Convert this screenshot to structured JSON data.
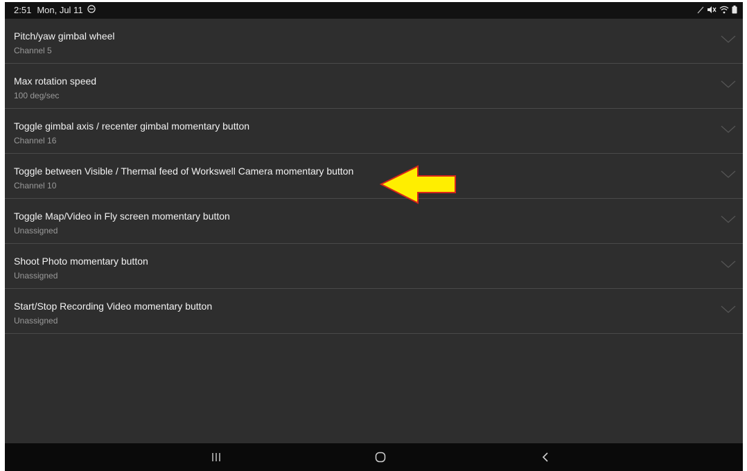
{
  "status_bar": {
    "time": "2:51",
    "date": "Mon, Jul 11",
    "icons": [
      "do-not-disturb-icon",
      "pen-icon",
      "mute-icon",
      "wifi-icon",
      "battery-icon"
    ]
  },
  "settings": {
    "items": [
      {
        "title": "Pitch/yaw gimbal wheel",
        "value": "Channel 5"
      },
      {
        "title": "Max rotation speed",
        "value": "100 deg/sec"
      },
      {
        "title": "Toggle gimbal axis / recenter gimbal momentary button",
        "value": "Channel 16"
      },
      {
        "title": "Toggle between Visible / Thermal feed of Workswell Camera momentary button",
        "value": "Channel 10"
      },
      {
        "title": "Toggle Map/Video in Fly screen momentary button",
        "value": "Unassigned"
      },
      {
        "title": "Shoot Photo momentary button",
        "value": "Unassigned"
      },
      {
        "title": "Start/Stop Recording Video momentary button",
        "value": "Unassigned"
      }
    ]
  },
  "annotation": {
    "shape": "arrow-left",
    "fill": "#ffee00",
    "stroke": "#d9261c"
  },
  "nav_bar": {
    "buttons": [
      "recents-icon",
      "home-icon",
      "back-icon"
    ]
  },
  "colors": {
    "background": "#2e2e2e",
    "status_bar": "#121212",
    "nav_bar": "#0a0a0a",
    "divider": "#4a4a4a",
    "title_text": "#f2f2f2",
    "subtitle_text": "#9a9a9a"
  }
}
